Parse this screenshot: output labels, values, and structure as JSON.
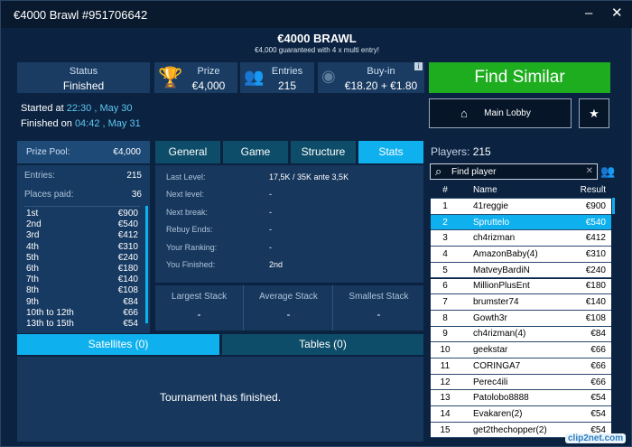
{
  "window": {
    "title": "€4000 Brawl #951706642",
    "minimize": "‒",
    "close": "✕"
  },
  "header": {
    "title": "€4000 BRAWL",
    "subtitle": "€4,000 guaranteed with 4 x multi entry!"
  },
  "stats": {
    "status_label": "Status",
    "status_value": "Finished",
    "prize_label": "Prize",
    "prize_value": "€4,000",
    "entries_label": "Entries",
    "entries_value": "215",
    "buyin_label": "Buy-in",
    "buyin_value": "€18.20 + €1.80",
    "info": "i"
  },
  "times": {
    "started_label": "Started at",
    "started_value": "22:30 , May 30",
    "finished_label": "Finished on",
    "finished_value": "04:42 , May 31"
  },
  "buttons": {
    "find_similar": "Find Similar",
    "main_lobby": "Main Lobby",
    "favorite": "★"
  },
  "prize_pool": {
    "label": "Prize Pool:",
    "value": "€4,000",
    "entries_label": "Entries:",
    "entries_value": "215",
    "places_label": "Places paid:",
    "places_value": "36",
    "places": [
      [
        "1st",
        "€900"
      ],
      [
        "2nd",
        "€540"
      ],
      [
        "3rd",
        "€412"
      ],
      [
        "4th",
        "€310"
      ],
      [
        "5th",
        "€240"
      ],
      [
        "6th",
        "€180"
      ],
      [
        "7th",
        "€140"
      ],
      [
        "8th",
        "€108"
      ],
      [
        "9th",
        "€84"
      ],
      [
        "10th to 12th",
        "€66"
      ],
      [
        "13th to 15th",
        "€54"
      ]
    ]
  },
  "tabs": {
    "general": "General",
    "game": "Game",
    "structure": "Structure",
    "stats": "Stats"
  },
  "stats_tab": {
    "rows": [
      [
        "Last Level:",
        "17,5K / 35K ante 3,5K"
      ],
      [
        "Next level:",
        "-"
      ],
      [
        "Next break:",
        "-"
      ],
      [
        "Rebuy Ends:",
        "-"
      ],
      [
        "Your Ranking:",
        "-"
      ],
      [
        "You Finished:",
        "2nd"
      ]
    ],
    "largest_label": "Largest Stack",
    "largest_value": "-",
    "average_label": "Average Stack",
    "average_value": "-",
    "smallest_label": "Smallest Stack",
    "smallest_value": "-"
  },
  "bottom_tabs": {
    "satellites": "Satellites (0)",
    "tables": "Tables (0)",
    "message": "Tournament has finished."
  },
  "players": {
    "label": "Players:",
    "count": "215",
    "search_placeholder": "Find player",
    "clear": "✕",
    "col_num": "#",
    "col_name": "Name",
    "col_result": "Result",
    "rows": [
      [
        "1",
        "41reggie",
        "€900"
      ],
      [
        "2",
        "Spruttelo",
        "€540"
      ],
      [
        "3",
        "ch4rizman",
        "€412"
      ],
      [
        "4",
        "AmazonBaby(4)",
        "€310"
      ],
      [
        "5",
        "MatveyBardiN",
        "€240"
      ],
      [
        "6",
        "MillionPlusEnt",
        "€180"
      ],
      [
        "7",
        "brumster74",
        "€140"
      ],
      [
        "8",
        "Gowth3r",
        "€108"
      ],
      [
        "9",
        "ch4rizman(4)",
        "€84"
      ],
      [
        "10",
        "geekstar",
        "€66"
      ],
      [
        "11",
        "CORINGA7",
        "€66"
      ],
      [
        "12",
        "Perec4ili",
        "€66"
      ],
      [
        "13",
        "Patolobo8888",
        "€54"
      ],
      [
        "14",
        "Evakaren(2)",
        "€54"
      ],
      [
        "15",
        "get2thechopper(2)",
        "€54"
      ]
    ]
  },
  "watermark": "clip2net.com",
  "colors": {
    "accent": "#0fb0ee",
    "green": "#1ead1f",
    "bg": "#0b2341"
  }
}
